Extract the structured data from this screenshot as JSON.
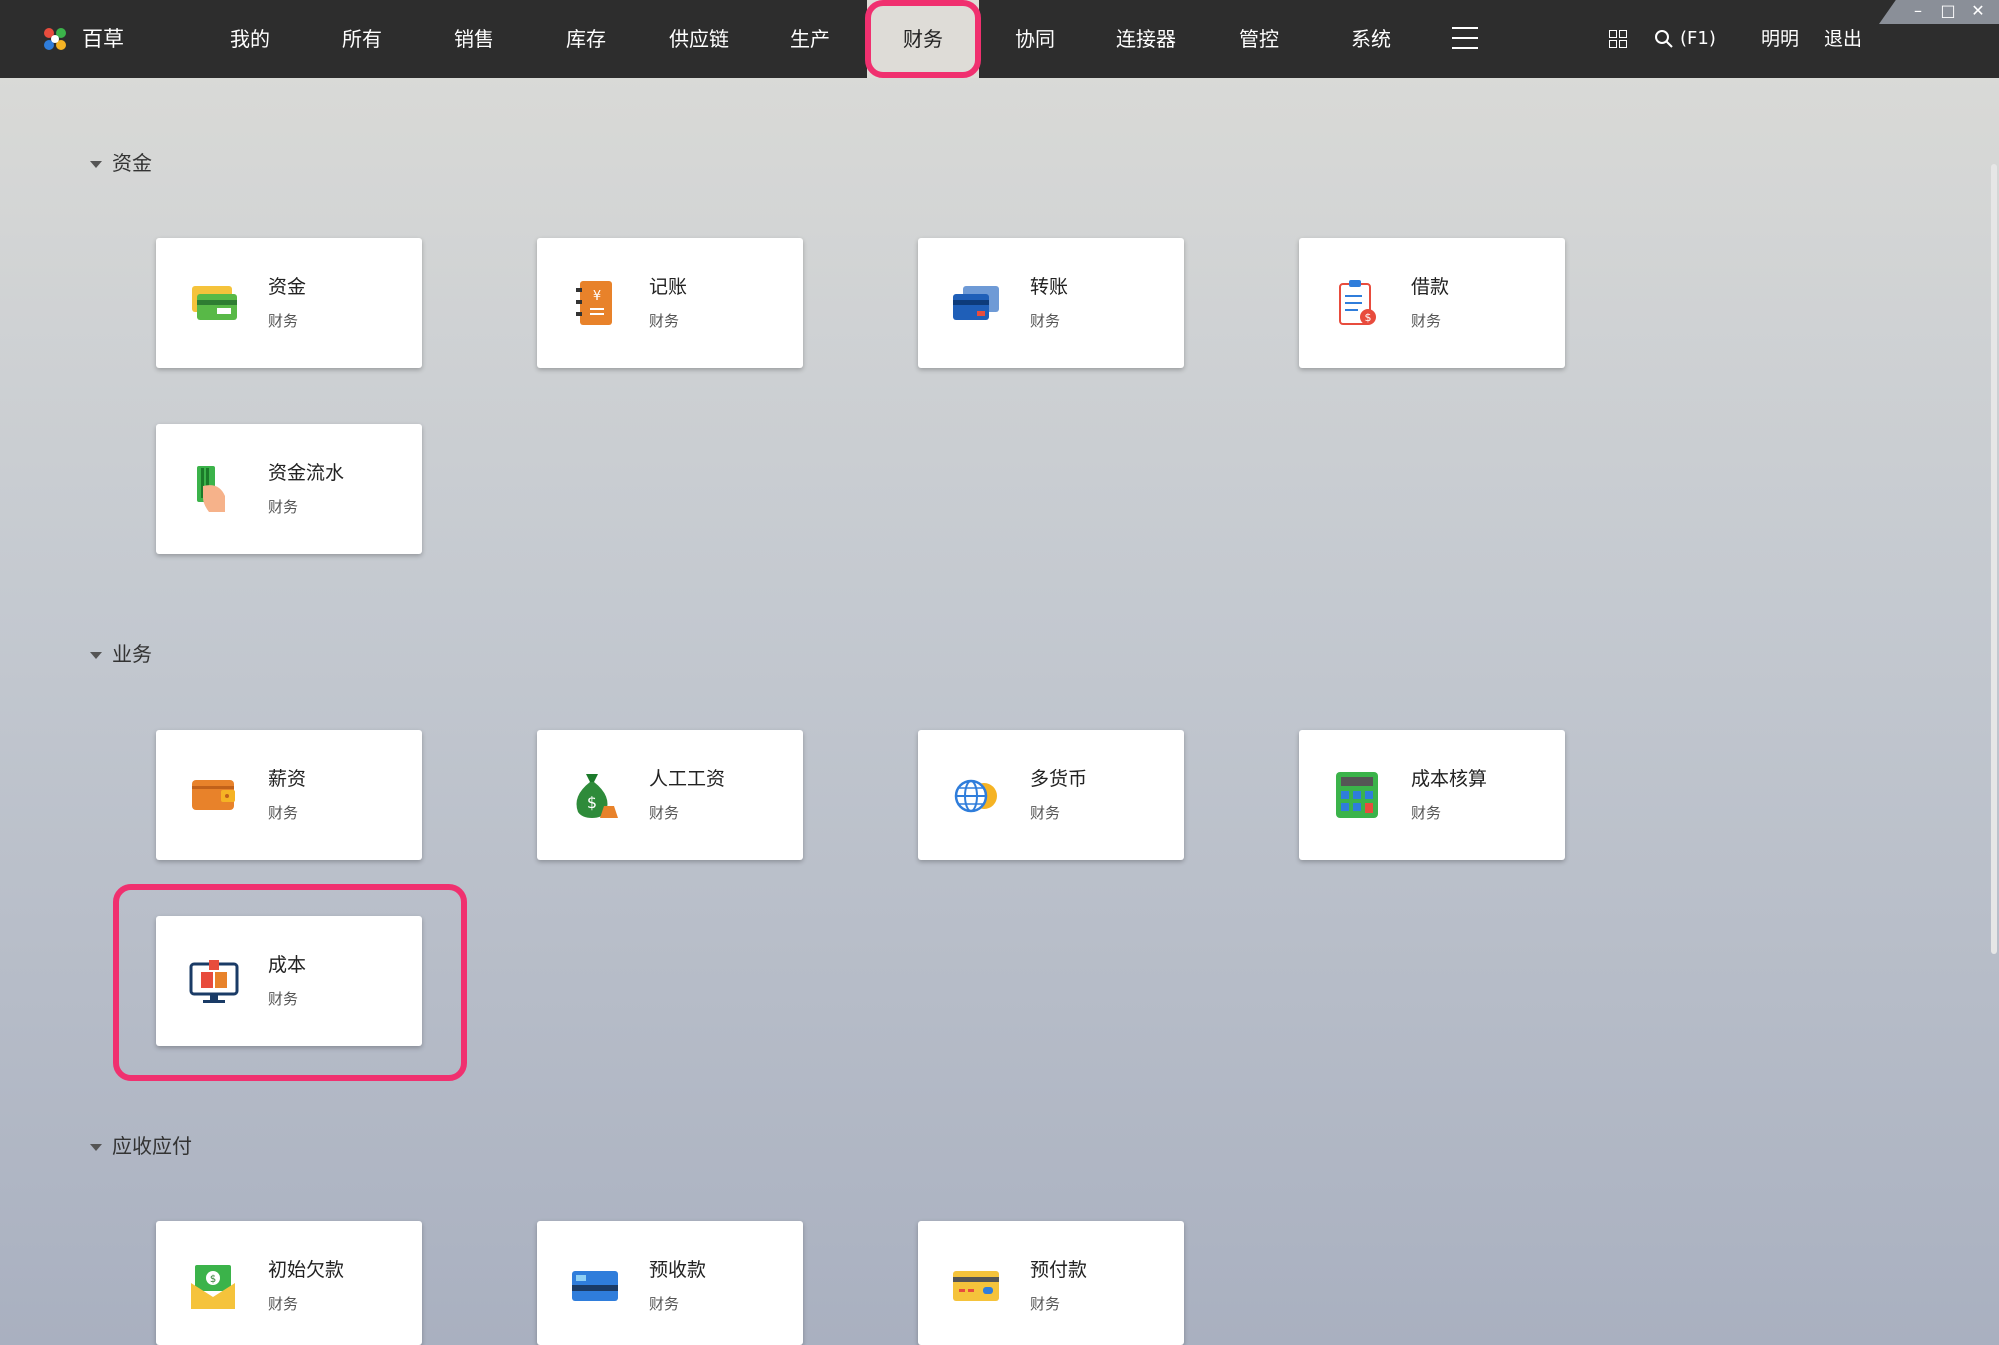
{
  "app": {
    "name": "百草"
  },
  "nav": {
    "items": [
      {
        "label": "我的"
      },
      {
        "label": "所有"
      },
      {
        "label": "销售"
      },
      {
        "label": "库存"
      },
      {
        "label": "供应链"
      },
      {
        "label": "生产"
      },
      {
        "label": "财务"
      },
      {
        "label": "协同"
      },
      {
        "label": "连接器"
      },
      {
        "label": "管控"
      },
      {
        "label": "系统"
      }
    ],
    "active": "财务"
  },
  "header": {
    "search_label": "(F1)",
    "user_name": "明明",
    "logout_label": "退出"
  },
  "window_controls": {
    "minimize": "–",
    "maximize": "□",
    "close": "✕"
  },
  "sections": [
    {
      "title": "资金",
      "cards": [
        {
          "title": "资金",
          "subtitle": "财务",
          "icon": "cash-card-icon"
        },
        {
          "title": "记账",
          "subtitle": "财务",
          "icon": "ledger-book-icon"
        },
        {
          "title": "转账",
          "subtitle": "财务",
          "icon": "transfer-cards-icon"
        },
        {
          "title": "借款",
          "subtitle": "财务",
          "icon": "loan-clipboard-icon"
        },
        {
          "title": "资金流水",
          "subtitle": "财务",
          "icon": "hand-card-icon"
        }
      ]
    },
    {
      "title": "业务",
      "cards": [
        {
          "title": "薪资",
          "subtitle": "财务",
          "icon": "wallet-icon"
        },
        {
          "title": "人工工资",
          "subtitle": "财务",
          "icon": "money-bag-icon"
        },
        {
          "title": "多货币",
          "subtitle": "财务",
          "icon": "globe-coin-icon"
        },
        {
          "title": "成本核算",
          "subtitle": "财务",
          "icon": "calculator-icon"
        },
        {
          "title": "成本",
          "subtitle": "财务",
          "icon": "monitor-box-icon"
        }
      ]
    },
    {
      "title": "应收应付",
      "cards": [
        {
          "title": "初始欠款",
          "subtitle": "财务",
          "icon": "envelope-money-icon"
        },
        {
          "title": "预收款",
          "subtitle": "财务",
          "icon": "blue-card-icon"
        },
        {
          "title": "预付款",
          "subtitle": "财务",
          "icon": "yellow-card-icon"
        }
      ]
    }
  ],
  "colors": {
    "highlight": "#f0306f",
    "topbar": "#2d2d2d",
    "active_tab": "#dedcd7"
  }
}
